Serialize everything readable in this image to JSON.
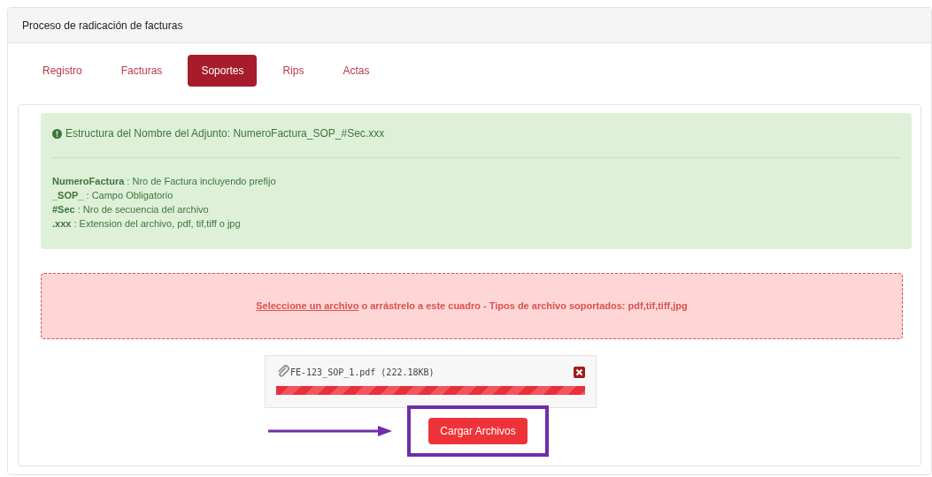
{
  "panel": {
    "title": "Proceso de radicación de facturas"
  },
  "tabs": [
    {
      "label": "Registro",
      "selected": false
    },
    {
      "label": "Facturas",
      "selected": false
    },
    {
      "label": "Soportes",
      "selected": true
    },
    {
      "label": "Rips",
      "selected": false
    },
    {
      "label": "Actas",
      "selected": false
    }
  ],
  "info": {
    "heading": "Estructura del Nombre del Adjunto: NumeroFactura_SOP_#Sec.xxx",
    "legend": [
      "**NumeroFactura** : Nro de Factura incluyendo prefijo",
      "**_SOP_** : Campo Obligatorio",
      "**#Sec** : Nro de secuencia del archivo",
      "**.xxx** : Extension del archivo, pdf, tif,tiff o jpg"
    ]
  },
  "dropzone": {
    "link": "Seleccione un archivo",
    "text": " o arrástrelo a este cuadro - Tipos de archivo soportados: pdf,tif,tiff,jpg"
  },
  "files": [
    {
      "name": "FE-123_SOP_1.pdf (222.18KB)"
    }
  ],
  "upload_button": "Cargar Archivos"
}
